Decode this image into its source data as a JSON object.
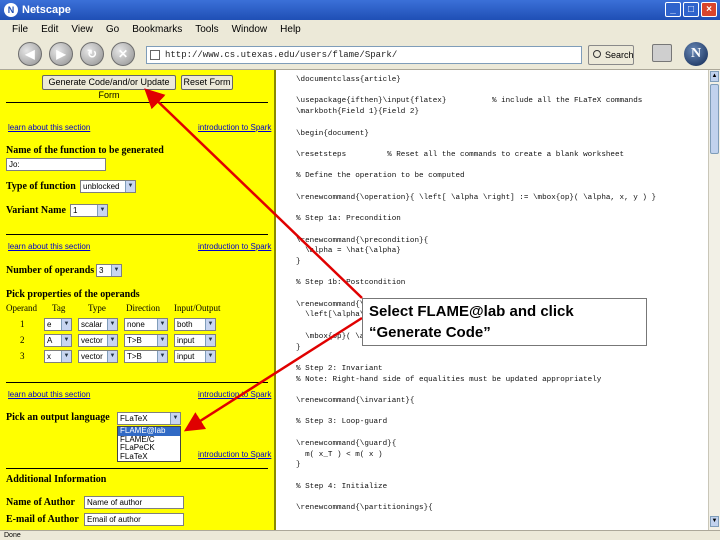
{
  "window": {
    "title": "Netscape",
    "minimize_glyph": "_",
    "maximize_glyph": "□",
    "close_glyph": "×"
  },
  "menu": [
    "File",
    "Edit",
    "View",
    "Go",
    "Bookmarks",
    "Tools",
    "Window",
    "Help"
  ],
  "toolbar": {
    "back_glyph": "◀",
    "forward_glyph": "▶",
    "reload_glyph": "↻",
    "stop_glyph": "✕",
    "url": "http://www.cs.utexas.edu/users/flame/Spark/",
    "search_label": "Search",
    "logo_letter": "N"
  },
  "form": {
    "generate_button": "Generate Code/and/or Update Form",
    "reset_button": "Reset Form",
    "learn_link": "learn about this section",
    "intro_link": "introduction to Spark",
    "function_name_label": "Name of the function to be generated",
    "function_name_value": "Jo:",
    "function_type_label": "Type of function",
    "function_type_value": "unblocked",
    "variant_label": "Variant Name",
    "variant_value": "1",
    "operands_label": "Number of operands",
    "operands_value": "3",
    "properties_label": "Pick properties of the operands",
    "columns": [
      "Operand",
      "Tag",
      "Type",
      "Direction",
      "Input/Output"
    ],
    "operands": [
      {
        "num": "1",
        "tag": "e",
        "type": "scalar",
        "direction": "none",
        "io": "both"
      },
      {
        "num": "2",
        "tag": "A",
        "type": "vector",
        "direction": "T>B",
        "io": "input"
      },
      {
        "num": "3",
        "tag": "x",
        "type": "vector",
        "direction": "T>B",
        "io": "input"
      }
    ],
    "language_label": "Pick an output language",
    "language_selected": "FLaTeX",
    "language_options": [
      "FLAME@lab",
      "FLAME/C",
      "FLaPeCK",
      "FLaTeX"
    ],
    "language_highlight_index": 0,
    "additional_label": "Additional Information",
    "author_label": "Name of Author",
    "author_value": "Name of author",
    "email_label": "E-mail of Author",
    "email_value": "Email of author"
  },
  "code_lines": [
    "\\documentclass{article}",
    "",
    "\\usepackage{ifthen}\\input{flatex}          % include all the FLaTeX commands",
    "\\markboth{Field 1}{Field 2}",
    "",
    "\\begin{document}",
    "",
    "\\resetsteps         % Reset all the commands to create a blank worksheet",
    "",
    "% Define the operation to be computed",
    "",
    "\\renewcommand{\\operation}{ \\left[ \\alpha \\right] := \\mbox{op}( \\alpha, x, y ) }",
    "",
    "% Step 1a: Precondition",
    "",
    "\\renewcommand{\\precondition}{",
    "  \\alpha = \\hat{\\alpha}",
    "}",
    "",
    "% Step 1b: Postcondition",
    "",
    "\\renewcommand{\\postcondition}{",
    "  \\left[\\alpha\\right] =",
    "",
    "  \\mbox{op}( \\alpha, x, y )",
    "}",
    "",
    "% Step 2: Invariant",
    "% Note: Right-hand side of equalities must be updated appropriately",
    "",
    "\\renewcommand{\\invariant}{",
    "",
    "% Step 3: Loop-guard",
    "",
    "\\renewcommand{\\guard}{",
    "  m( x_T ) < m( x )",
    "}",
    "",
    "% Step 4: Initialize",
    "",
    "\\renewcommand{\\partitionings}{"
  ],
  "callout": {
    "line1": "Select FLAME@lab and click",
    "line2": "“Generate Code”"
  },
  "status": "Done",
  "colors": {
    "form_bg": "#ffff00",
    "arrow": "#e00000",
    "link": "#0000cc"
  }
}
